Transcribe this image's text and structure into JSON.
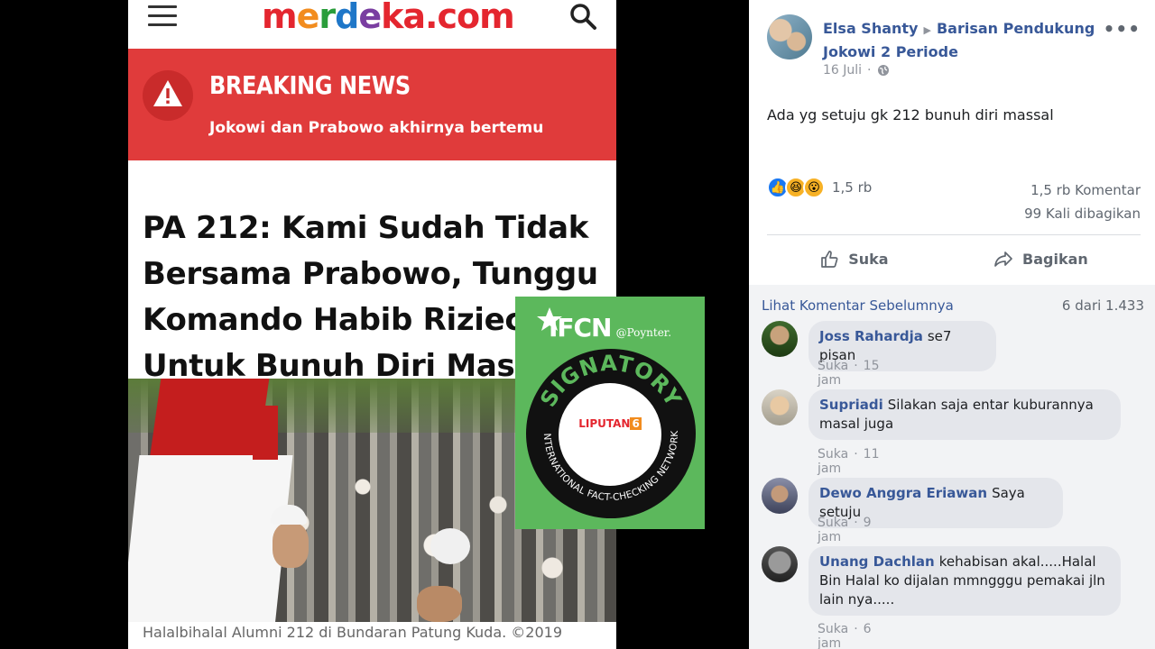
{
  "article": {
    "logo_parts": [
      "m",
      "e",
      "r",
      "d",
      "e",
      "ka.com"
    ],
    "breaking_title": "BREAKING NEWS",
    "breaking_subtitle": "Jokowi dan Prabowo akhirnya bertemu",
    "headline_lines": [
      "PA 212: Kami Sudah Tidak",
      "Bersama Prabowo, Tunggu",
      "Komando Habib Riziec",
      "Untuk Bunuh Diri Massal"
    ],
    "caption": "Halalbihalal Alumni 212 di Bundaran Patung Kuda. ©2019"
  },
  "ifcn_badge": {
    "logo": "IFCN",
    "poynter": "@Poynter.",
    "ring_top": "SIGNATORY",
    "ring_bottom": "INTERNATIONAL FACT-CHECKING NETWORK",
    "center_brand": "LIPUTAN",
    "center_brand_num": "6"
  },
  "post": {
    "author": "Elsa Shanty",
    "group": "Barisan Pendukung Jokowi 2 Periode",
    "date": "16 Juli",
    "privacy_icon": "globe-icon",
    "more": "•••",
    "text": "Ada yg setuju gk 212 bunuh diri massal",
    "reactions_count": "1,5 rb",
    "comments_count": "1,5 rb Komentar",
    "shares_count": "99 Kali dibagikan",
    "like_label": "Suka",
    "share_label": "Bagikan"
  },
  "comments_header": {
    "prev_link": "Lihat Komentar Sebelumnya",
    "count": "6 dari 1.433"
  },
  "comments": [
    {
      "name": "Joss Rahardja",
      "text": "se7 pisan",
      "like": "Suka",
      "time": "15 jam"
    },
    {
      "name": "Supriadi",
      "text": "Silakan saja entar kuburannya masal juga",
      "like": "Suka",
      "time": "11 jam"
    },
    {
      "name": "Dewo Anggra Eriawan",
      "text": "Saya setuju",
      "like": "Suka",
      "time": "9 jam"
    },
    {
      "name": "Unang Dachlan",
      "text": "kehabisan akal.....Halal Bin Halal ko dijalan mmngggu pemakai jln lain nya.....",
      "like": "Suka",
      "time": "6 jam"
    }
  ],
  "colors": {
    "breaking_red": "#e03b3b",
    "fb_link": "#385898",
    "ifcn_green": "#5cb85c"
  }
}
